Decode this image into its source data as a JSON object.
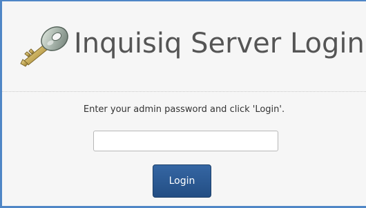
{
  "header": {
    "title": "Inquisiq Server Login",
    "icon": "key-icon"
  },
  "form": {
    "instruction": "Enter your admin password and click 'Login'.",
    "password_value": "",
    "password_placeholder": "",
    "login_label": "Login"
  },
  "colors": {
    "frame_border": "#4f86c6",
    "background": "#f6f6f6",
    "button": "#2a5a94"
  }
}
